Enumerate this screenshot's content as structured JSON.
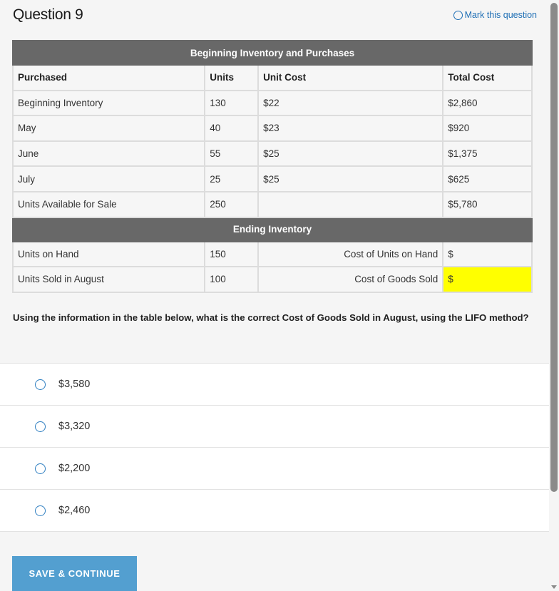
{
  "header": {
    "title": "Question 9",
    "mark_label": "Mark this question"
  },
  "table": {
    "section1_title": "Beginning Inventory and Purchases",
    "columns": [
      "Purchased",
      "Units",
      "Unit Cost",
      "Total Cost"
    ],
    "rows": [
      {
        "label": "Beginning Inventory",
        "units": "130",
        "unit_cost": "$22",
        "total": "$2,860"
      },
      {
        "label": "May",
        "units": "40",
        "unit_cost": "$23",
        "total": "$920"
      },
      {
        "label": "June",
        "units": "55",
        "unit_cost": "$25",
        "total": "$1,375"
      },
      {
        "label": "July",
        "units": "25",
        "unit_cost": "$25",
        "total": "$625"
      },
      {
        "label": "Units Available for Sale",
        "units": "250",
        "unit_cost": "",
        "total": "$5,780"
      }
    ],
    "section2_title": "Ending Inventory",
    "ending_rows": [
      {
        "label": "Units on Hand",
        "units": "150",
        "cost_label": "Cost of Units on Hand",
        "value": "$",
        "highlight": false
      },
      {
        "label": "Units Sold in August",
        "units": "100",
        "cost_label": "Cost of Goods Sold",
        "value": "$",
        "highlight": true
      }
    ],
    "highlight_color": "#ffff00"
  },
  "question": {
    "prompt": "Using the information in the table below, what is the correct Cost of Goods Sold in August, using the LIFO method?"
  },
  "answers": [
    {
      "label": "$3,580",
      "selected": false
    },
    {
      "label": "$3,320",
      "selected": false
    },
    {
      "label": "$2,200",
      "selected": false
    },
    {
      "label": "$2,460",
      "selected": false
    }
  ],
  "footer": {
    "save_label": "SAVE & CONTINUE"
  },
  "colors": {
    "accent": "#1f6fb5",
    "button": "#539fd0",
    "band": "#686868"
  }
}
